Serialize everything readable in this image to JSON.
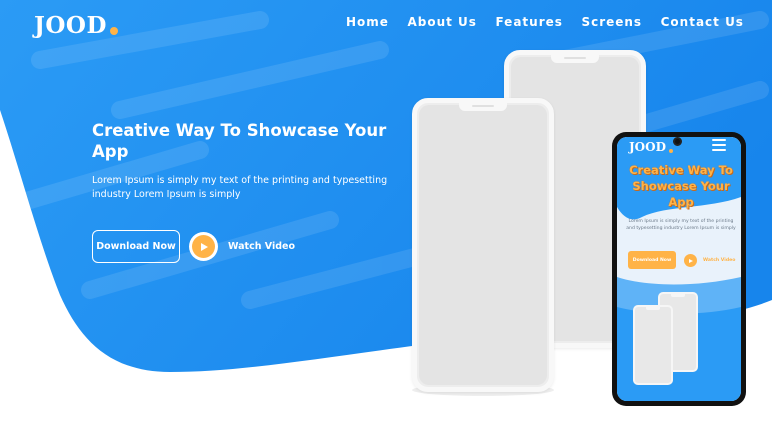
{
  "brand": {
    "name": "JOOD"
  },
  "nav": {
    "items": [
      "Home",
      "About Us",
      "Features",
      "Screens",
      "Contact Us"
    ]
  },
  "hero": {
    "title": "Creative Way To Showcase Your App",
    "description": "Lorem Ipsum is simply my text of the printing and typesetting industry Lorem Ipsum is simply",
    "download_label": "Download Now",
    "watch_label": "Watch Video"
  },
  "preview": {
    "brand": "JOOD",
    "title": "Creative Way To Showcase Your App",
    "description": "Lorem Ipsum is simply my text of the printing and typesetting industry Lorem Ipsum is simply",
    "download_label": "Download Now",
    "watch_label": "Watch Video"
  },
  "colors": {
    "primary": "#1e8ff0",
    "primary_light": "#4aa9f5",
    "accent": "#ffb347",
    "text_on_primary": "#ffffff",
    "mockup": "#e4e4e4"
  },
  "icons": [
    "play-icon",
    "menu-icon"
  ]
}
